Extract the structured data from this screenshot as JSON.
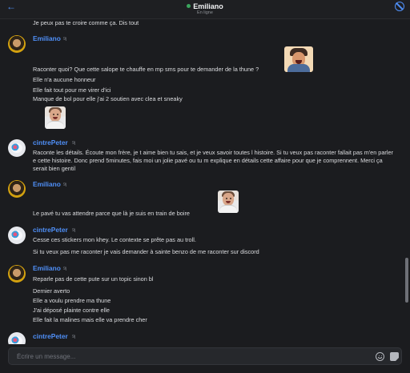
{
  "header": {
    "back_icon": "arrow-left-icon",
    "name": "Emiliano",
    "status": "En ligne",
    "online_color": "#3ba55d",
    "block_icon": "block-icon"
  },
  "accent": "#4f8ff7",
  "messages": [
    {
      "kind": "text",
      "text": "Je peux pas te croire comme ça. Dis tout"
    },
    {
      "kind": "author",
      "author": "Emiliano",
      "time": "9j"
    },
    {
      "kind": "text",
      "text": "Raconter quoi? Que cette salope te chauffe en mp sms pour te demander de la thune ?"
    },
    {
      "kind": "text",
      "text": "Elle n'a aucune honneur"
    },
    {
      "kind": "text",
      "text": "Elle fait tout pour me virer d'ici"
    },
    {
      "kind": "text",
      "text": "Manque de bol pour elle j'ai 2 soutien avec clea et sneaky"
    },
    {
      "kind": "author",
      "author": "cintrePeter",
      "time": "9j"
    },
    {
      "kind": "text",
      "text": "Raconte les détails. Écoute mon frère, je t aime bien tu sais, et je veux savoir toutes l histoire. Si tu veux pas raconter fallait pas m'en parler e cette histoire. Donc prend 5minutes, fais moi un jolie pavé ou tu m explique en détails cette affaire pour que je comprennent. Merci ça serait bien gentil"
    },
    {
      "kind": "author",
      "author": "Emiliano",
      "time": "9j"
    },
    {
      "kind": "text",
      "text": "Le pavé tu vas attendre parce que là je suis en train de boire"
    },
    {
      "kind": "author",
      "author": "cintrePeter",
      "time": "9j"
    },
    {
      "kind": "text",
      "text": "Cesse ces stickers mon khey. Le contexte se prête pas au troll."
    },
    {
      "kind": "text",
      "text": "Si tu veux pas me raconter je vais demander à sainte benzo de me raconter sur discord"
    },
    {
      "kind": "author",
      "author": "Emiliano",
      "time": "9j"
    },
    {
      "kind": "text",
      "text": "Reparle pas de cette pute sur un topic sinon bl"
    },
    {
      "kind": "text",
      "text": "Dernier averto"
    },
    {
      "kind": "text",
      "text": "Elle a voulu prendre ma thune"
    },
    {
      "kind": "text",
      "text": "J'ai déposé plainte contre elle"
    },
    {
      "kind": "text",
      "text": "Elle fait la malines mais elle va prendre cher"
    },
    {
      "kind": "author",
      "author": "cintrePeter",
      "time": "9j"
    }
  ],
  "composer": {
    "placeholder": "Écrire un message...",
    "emoji_icon": "emoji-icon",
    "sticker_icon": "sticker-icon"
  }
}
